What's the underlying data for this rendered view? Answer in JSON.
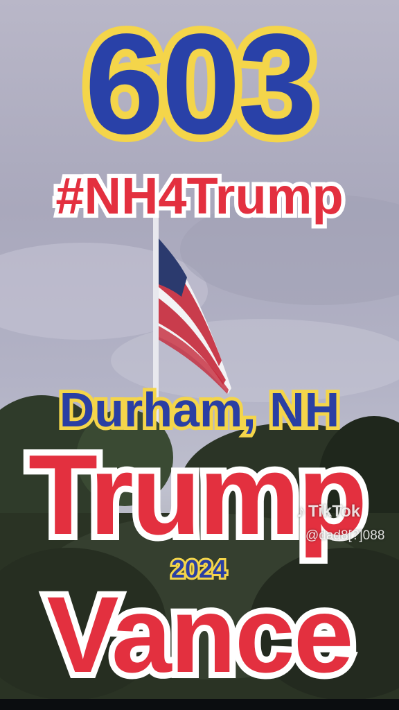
{
  "overlay": {
    "area_code": "603",
    "hashtag": "#NH4Trump",
    "location": "Durham, NH",
    "line_trump": "Trump",
    "year": "2024",
    "line_vance": "Vance"
  },
  "watermark": {
    "icon": "tiktok-note-icon",
    "brand": "TikTok",
    "handle": "@dad8[?]088"
  },
  "colors": {
    "blue": "#2a3fa3",
    "yellow": "#f4d54a",
    "red": "#e3303f",
    "white": "#ffffff"
  }
}
